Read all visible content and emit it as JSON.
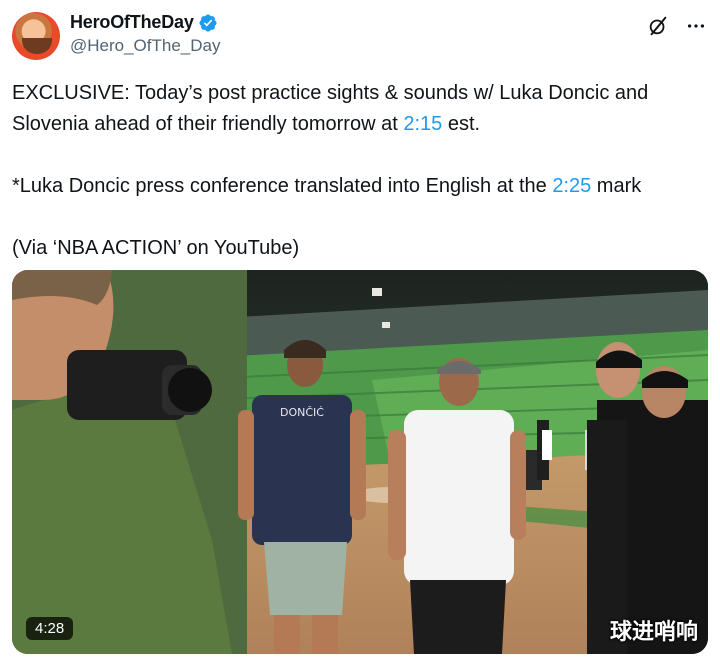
{
  "author": {
    "display_name": "HeroOfTheDay",
    "handle": "@Hero_OfThe_Day"
  },
  "actions": {
    "grok_icon": "grok-slash-icon",
    "more_icon": "more-dots-icon"
  },
  "tweet": {
    "p1_a": "EXCLUSIVE: Today’s post practice sights & sounds w/ Luka Doncic and Slovenia ahead of their friendly tomorrow at ",
    "p1_link": "2:15",
    "p1_b": " est.",
    "p2_a": "*Luka Doncic press conference translated into English at the ",
    "p2_link": "2:25",
    "p2_b": " mark",
    "p3": "(Via ‘NBA ACTION’ on YouTube)"
  },
  "video": {
    "duration": "4:28",
    "watermark": "球进哨响",
    "jersey": "DONČIĆ"
  },
  "colors": {
    "link": "#1d9bf0",
    "verified": "#1d9bf0",
    "text": "#0f1419",
    "secondary": "#536471"
  }
}
